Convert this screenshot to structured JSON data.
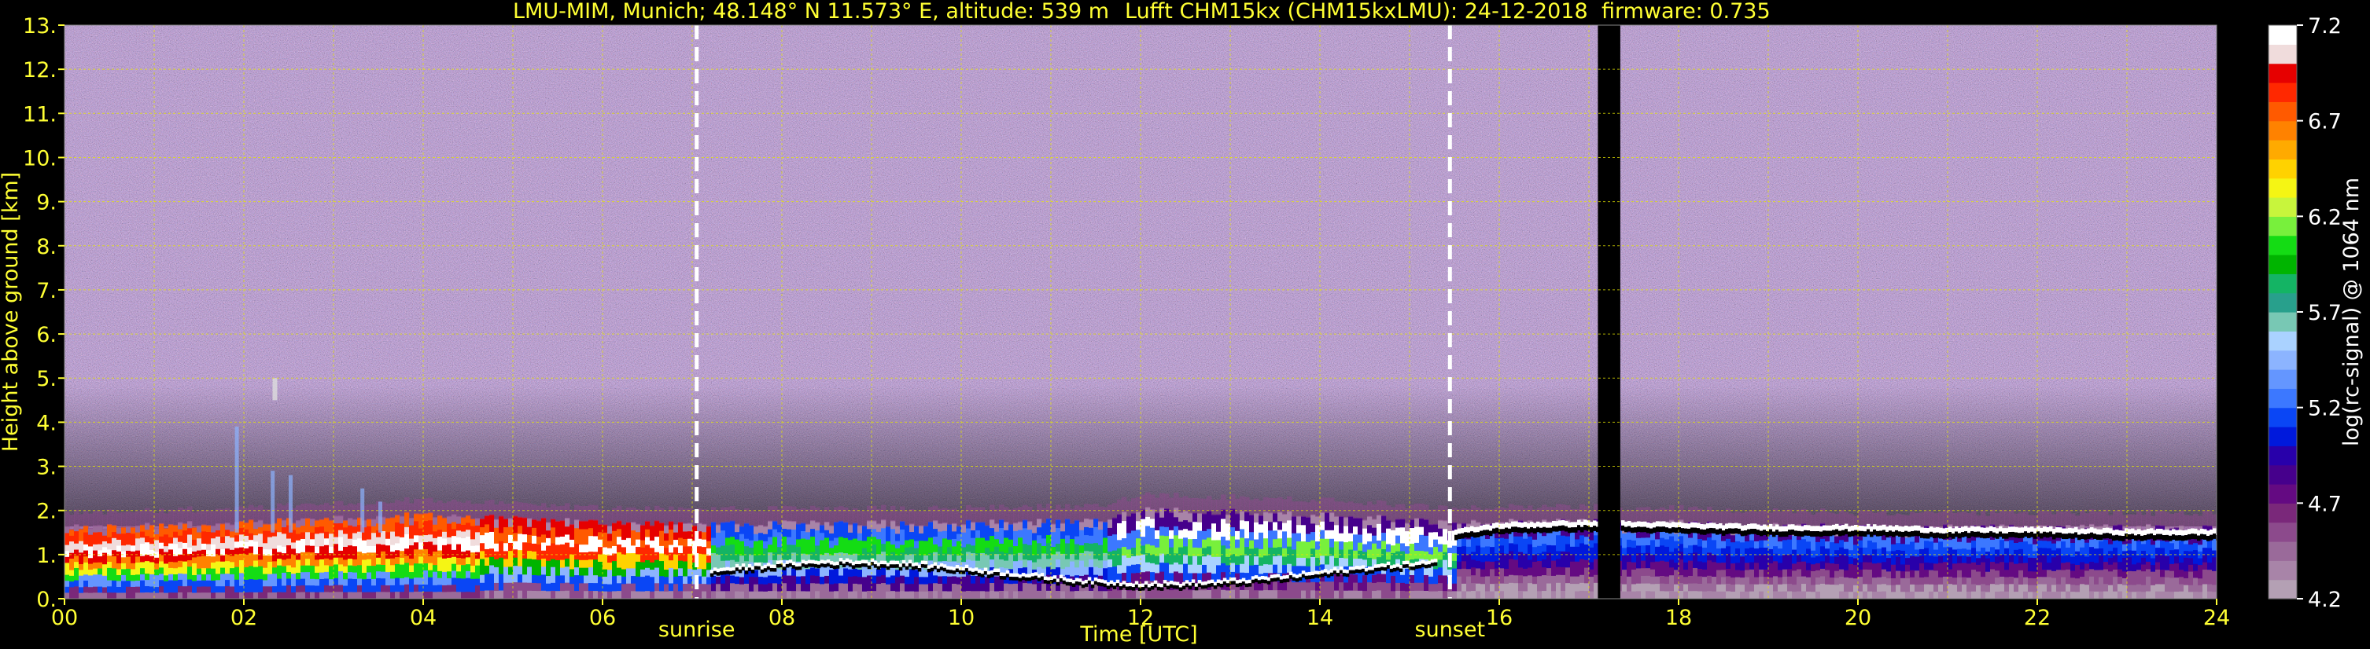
{
  "header": {
    "site": "LMU-MIM, Munich; 48.148° N 11.573° E, altitude: 539 m",
    "instrument": "Lufft CHM15kx (CHM15kxLMU): 24-12-2018",
    "firmware": "firmware: 0.735"
  },
  "colors": {
    "text_yellow": "#ffff33",
    "grid_yellow": "#e6e600",
    "background": "#000000",
    "colorbar_label": "#ffffff"
  },
  "chart_data": {
    "type": "heatmap",
    "title": "LMU-MIM, Munich; 48.148° N 11.573° E, altitude: 539 m    Lufft CHM15kx (CHM15kxLMU): 24-12-2018    firmware: 0.735",
    "xlabel": "Time [UTC]",
    "ylabel": "Height above ground [km]",
    "xlim": [
      0,
      24
    ],
    "ylim": [
      0,
      13
    ],
    "x_tick_labels": [
      "00",
      "02",
      "04",
      "06",
      "08",
      "10",
      "12",
      "14",
      "16",
      "18",
      "20",
      "22",
      "24"
    ],
    "y_tick_labels": [
      "0.",
      "1.",
      "2.",
      "3.",
      "4.",
      "5.",
      "6.",
      "7.",
      "8.",
      "9.",
      "10.",
      "11.",
      "12.",
      "13."
    ],
    "grid": true,
    "markers": [
      {
        "label": "sunrise",
        "x": 7.05
      },
      {
        "label": "sunset",
        "x": 15.45
      }
    ],
    "data_gap": {
      "x_start": 17.1,
      "x_end": 17.35
    },
    "colorbar": {
      "label": "log(rc-signal) @ 1064 nm",
      "range": [
        4.2,
        7.2
      ],
      "tick_labels": [
        "4.2",
        "4.7",
        "5.2",
        "5.7",
        "6.2",
        "6.7",
        "7.2"
      ],
      "colors": [
        "#b4a0b4",
        "#a884a8",
        "#9a6a9a",
        "#8c4a8c",
        "#7a287a",
        "#640a82",
        "#46008c",
        "#2800aa",
        "#0019dc",
        "#0a46f5",
        "#3c78ff",
        "#6496ff",
        "#8cb4ff",
        "#aad2ff",
        "#78c8b4",
        "#28a08c",
        "#14b464",
        "#00b400",
        "#14dc14",
        "#78f03c",
        "#c8f53c",
        "#f5f514",
        "#ffd200",
        "#ffaa00",
        "#ff8200",
        "#ff5a00",
        "#ff2800",
        "#e60000",
        "#f0dcdc",
        "#ffffff"
      ]
    },
    "layers": [
      {
        "name": "noise",
        "description_values": "noisy background above 2 km"
      },
      {
        "name": "boundary_layer_top_km",
        "x": [
          0,
          2,
          4,
          6,
          8,
          10,
          11.5,
          12,
          14,
          15.5,
          16,
          18,
          20,
          22,
          24
        ],
        "y": [
          1.6,
          1.7,
          1.9,
          1.7,
          1.7,
          1.7,
          1.75,
          2.0,
          1.9,
          1.7,
          1.75,
          1.7,
          1.6,
          1.6,
          1.6
        ]
      },
      {
        "name": "cloud_layer_km",
        "x": [
          15.5,
          16,
          17,
          18,
          19,
          20,
          21,
          22,
          23,
          24
        ],
        "y": [
          1.45,
          1.6,
          1.65,
          1.6,
          1.55,
          1.55,
          1.5,
          1.5,
          1.45,
          1.45
        ]
      }
    ]
  }
}
